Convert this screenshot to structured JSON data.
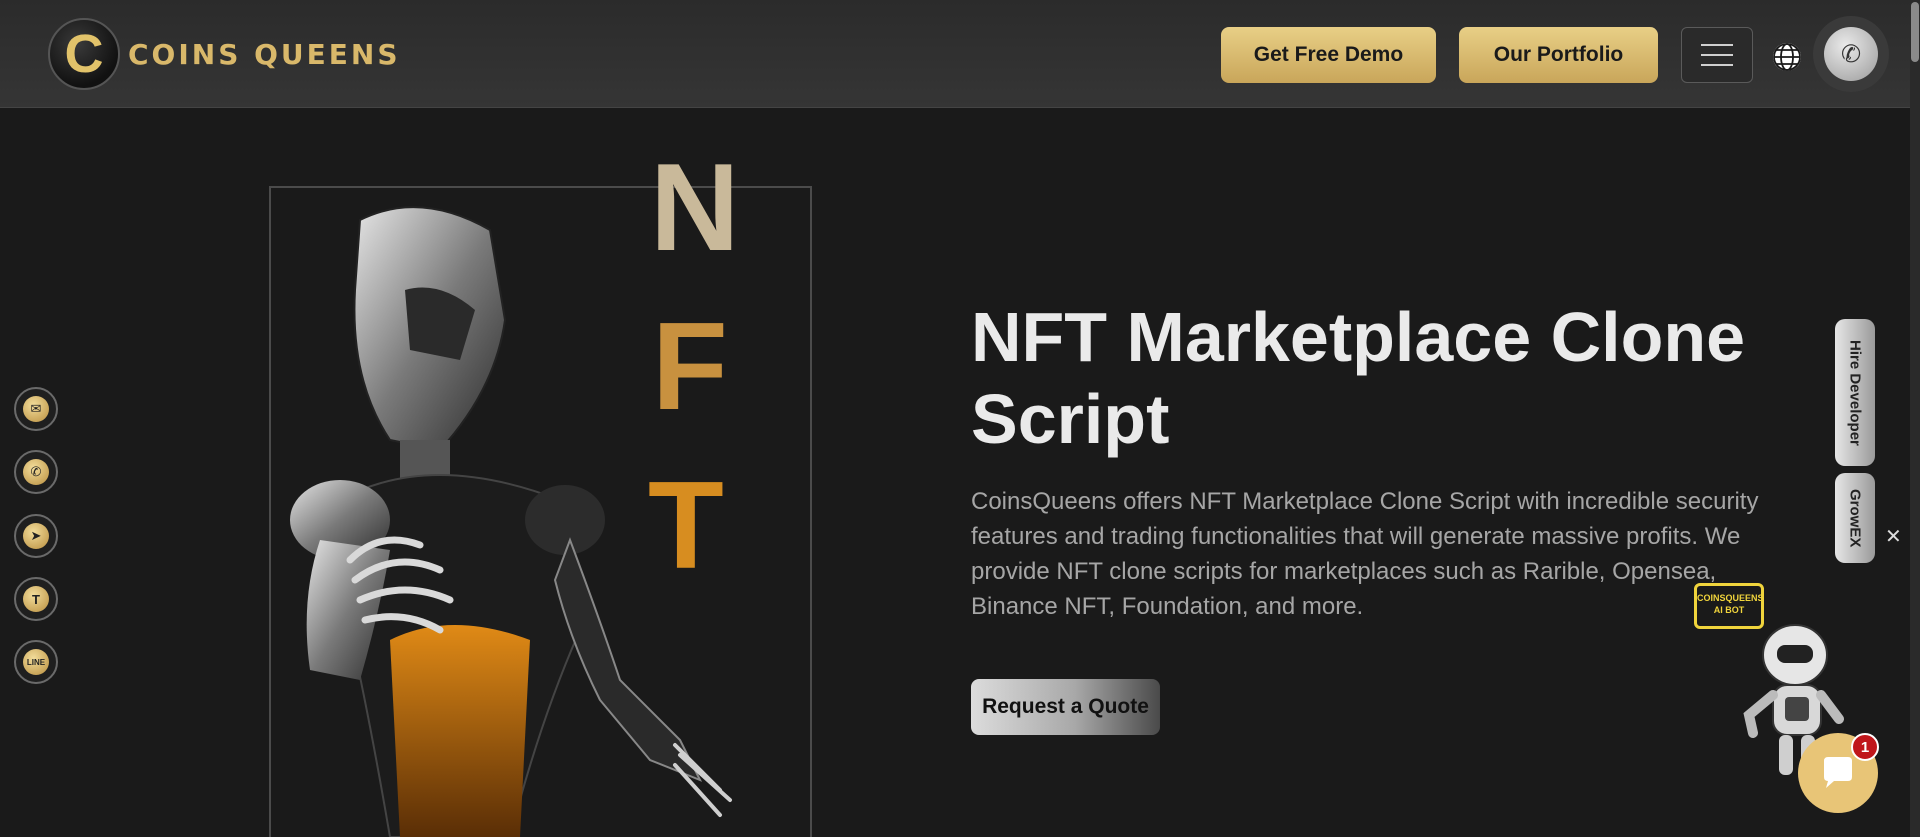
{
  "header": {
    "logo_letter": "C",
    "logo_text": "COINS QUEENS",
    "demo_button": "Get Free Demo",
    "portfolio_button": "Our Portfolio",
    "menu_icon": "hamburger-icon",
    "language_icon": "globe-icon",
    "call_icon": "phone-icon"
  },
  "social": [
    {
      "name": "email",
      "icon": "mail-icon",
      "glyph": "✉"
    },
    {
      "name": "whatsapp",
      "icon": "whatsapp-icon",
      "glyph": "✆"
    },
    {
      "name": "telegram",
      "icon": "telegram-icon",
      "glyph": "➤"
    },
    {
      "name": "teams",
      "icon": "teams-icon",
      "glyph": "T"
    },
    {
      "name": "line",
      "icon": "line-icon",
      "glyph": "LINE"
    }
  ],
  "hero": {
    "nft_letters": [
      "N",
      "F",
      "T"
    ],
    "title": "NFT Marketplace Clone Script",
    "description": "CoinsQueens offers NFT Marketplace Clone Script with incredible security features and trading functionalities that will generate massive profits. We provide NFT clone scripts for marketplaces such as Rarible, Opensea, Binance NFT, Foundation, and more.",
    "quote_button": "Request a Quote"
  },
  "side_tabs": {
    "hire": "Hire Developer",
    "growex": "GrowEX",
    "close": "✕"
  },
  "chat": {
    "bot_bubble": "COINSQUEENS AI BOT",
    "badge_count": "1",
    "icon": "chat-bubble-icon"
  },
  "colors": {
    "background": "#1a1a1a",
    "gold": "#d9b86a",
    "header": "#333333"
  }
}
